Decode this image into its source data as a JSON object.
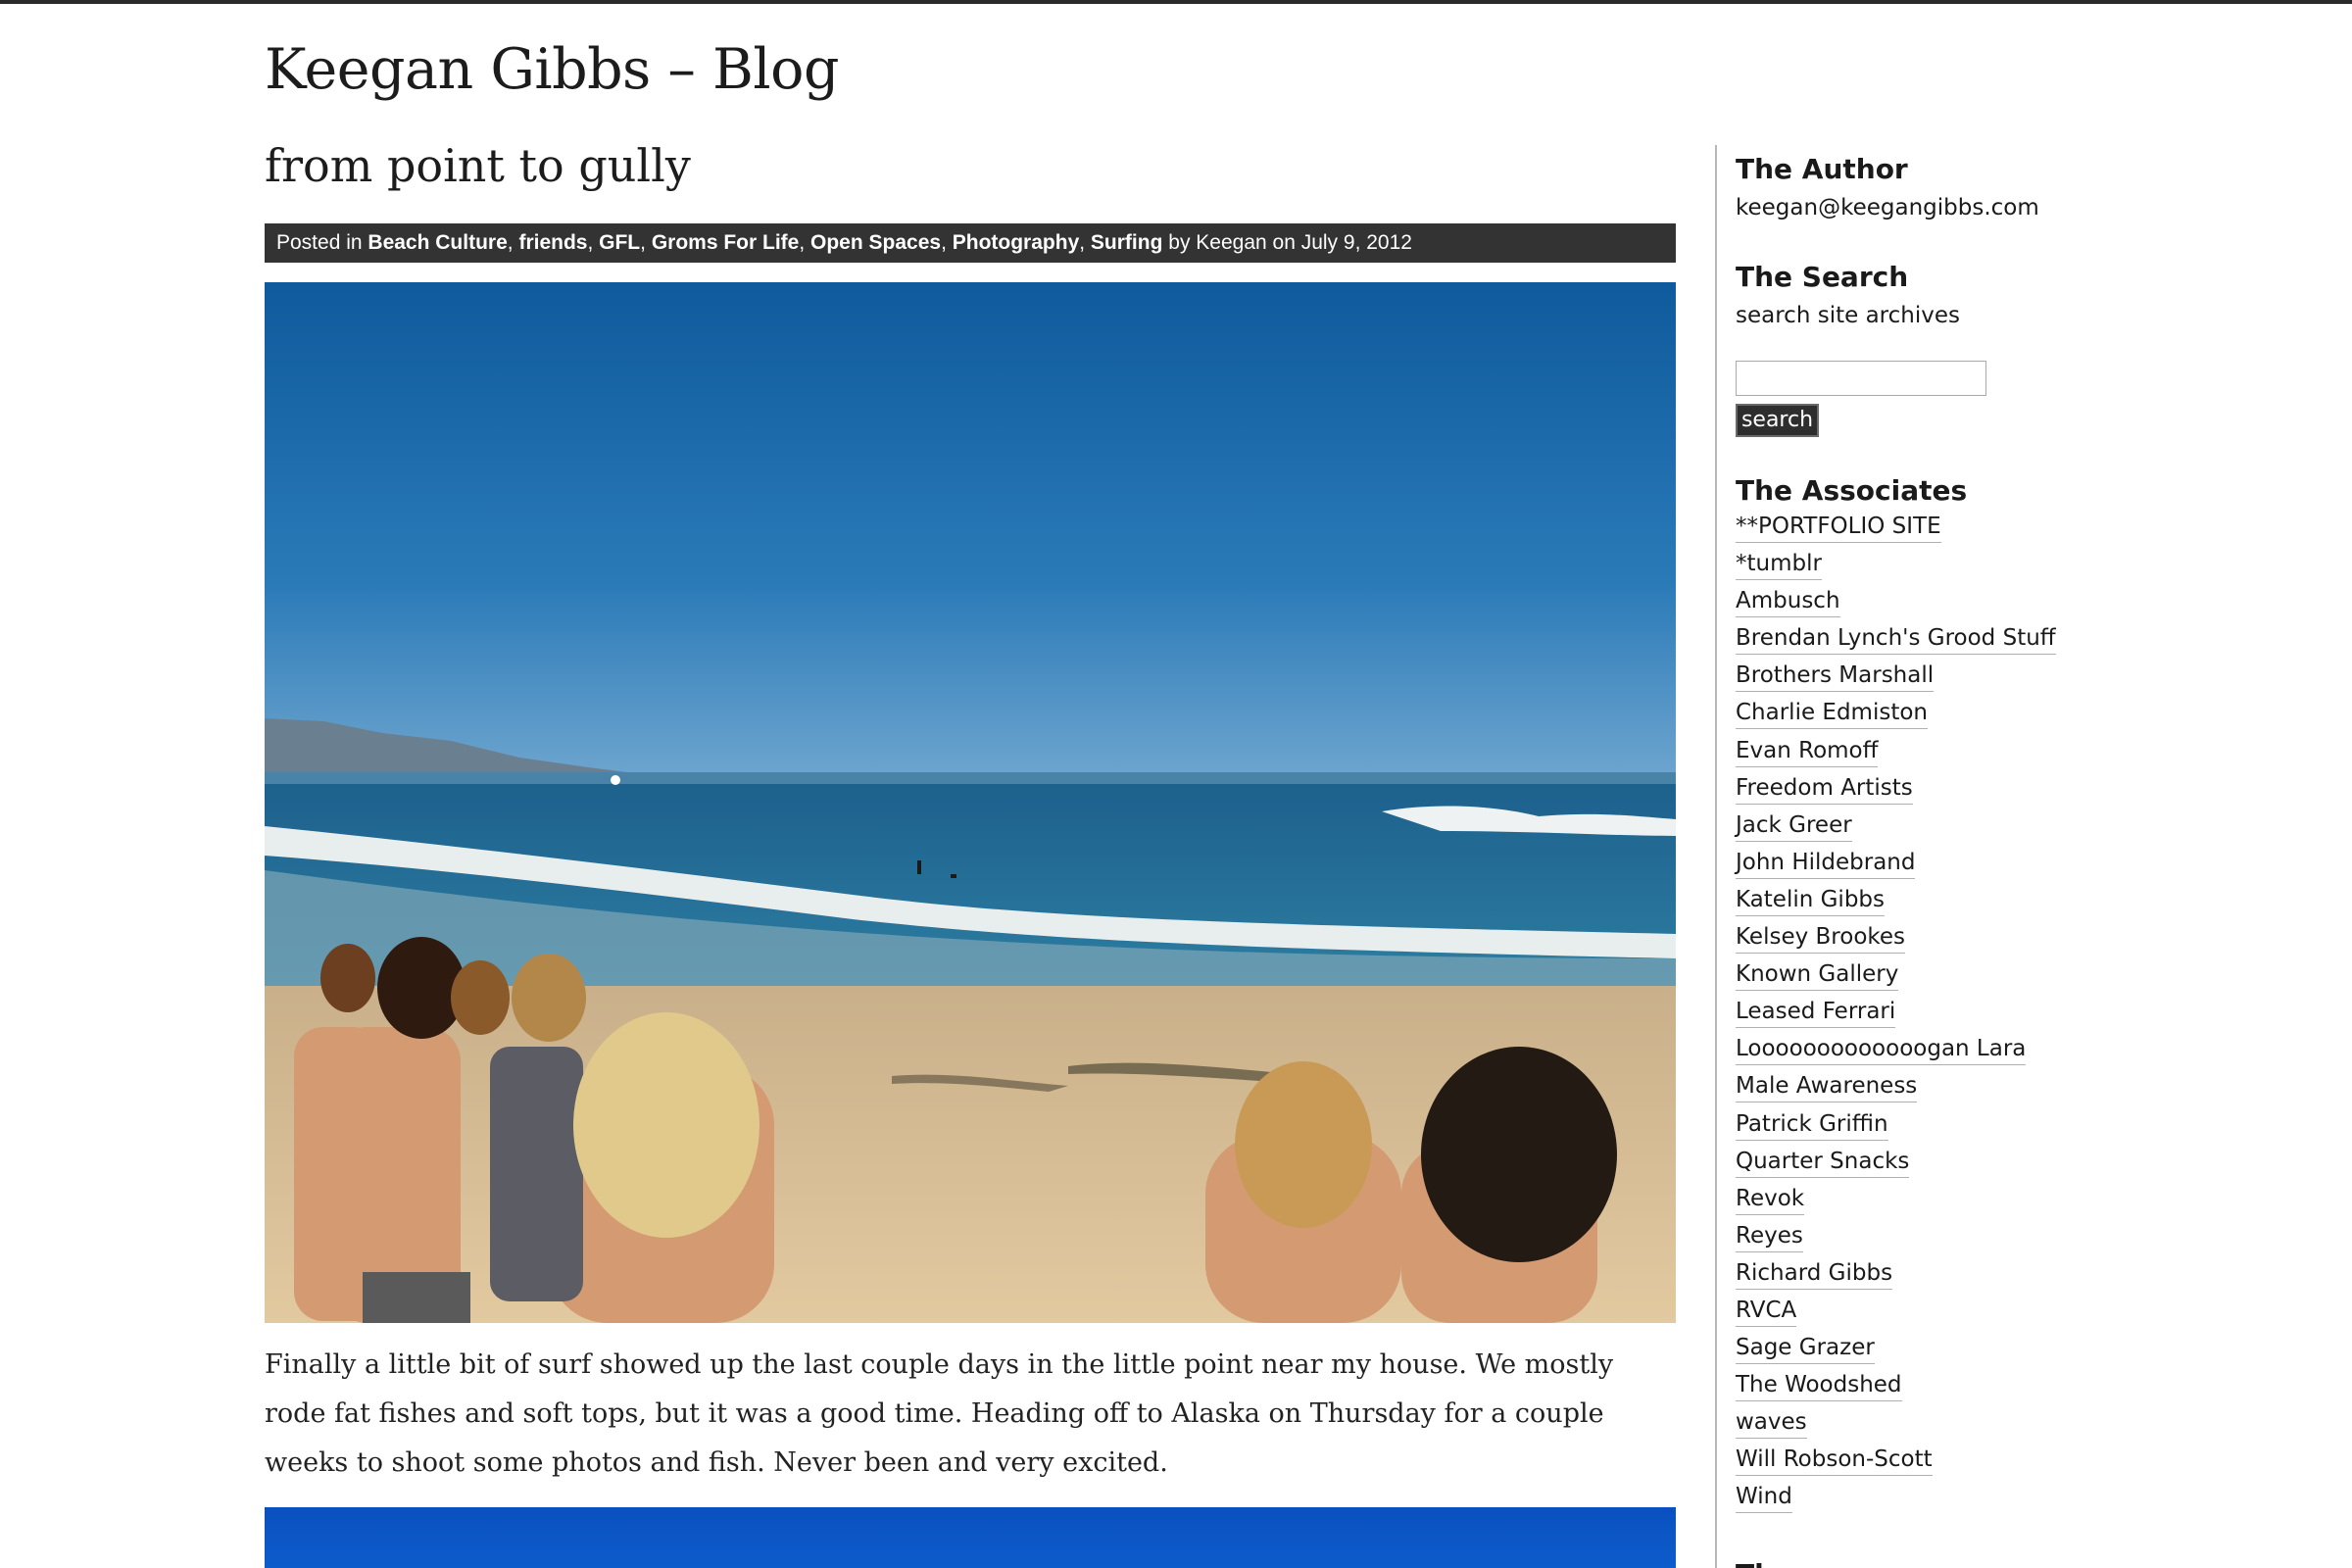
{
  "site": {
    "title": "Keegan Gibbs – Blog"
  },
  "post": {
    "title": "from point to gully",
    "meta": {
      "posted_in": "Posted in",
      "categories": [
        "Beach Culture",
        "friends",
        "GFL",
        "Groms For Life",
        "Open Spaces",
        "Photography",
        "Surfing"
      ],
      "by": "by Keegan on July 9, 2012"
    },
    "body": "Finally a little bit of surf showed up the last couple days in the little point near my house. We mostly rode fat fishes and soft tops, but it was a good time. Heading off to Alaska on Thursday for a couple weeks to shoot some photos and fish.  Never been and very excited."
  },
  "sidebar": {
    "author": {
      "heading": "The Author",
      "email": "keegan@keegangibbs.com"
    },
    "search": {
      "heading": "The Search",
      "subtext": "search site archives",
      "button": "search"
    },
    "associates": {
      "heading": "The Associates",
      "links": [
        "**PORTFOLIO SITE",
        "*tumblr",
        "Ambusch",
        "Brendan Lynch's Grood Stuff",
        "Brothers Marshall",
        "Charlie Edmiston",
        "Evan Romoff",
        "Freedom Artists",
        "Jack Greer",
        "John Hildebrand",
        "Katelin Gibbs",
        "Kelsey Brookes",
        "Known Gallery",
        "Leased Ferrari",
        "Looooooooooooogan Lara",
        "Male Awareness",
        "Patrick Griffin",
        "Quarter Snacks",
        "Revok",
        "Reyes",
        "Richard Gibbs",
        "RVCA",
        "Sage Grazer",
        "The Woodshed",
        "waves",
        "Will Robson-Scott",
        "Wind"
      ]
    },
    "next_heading": "The Archives"
  },
  "colors": {
    "meta_bar": "#333333",
    "sky": "#1f6fb0",
    "sand": "#d8bc92",
    "foam": "#f2f4f2"
  }
}
